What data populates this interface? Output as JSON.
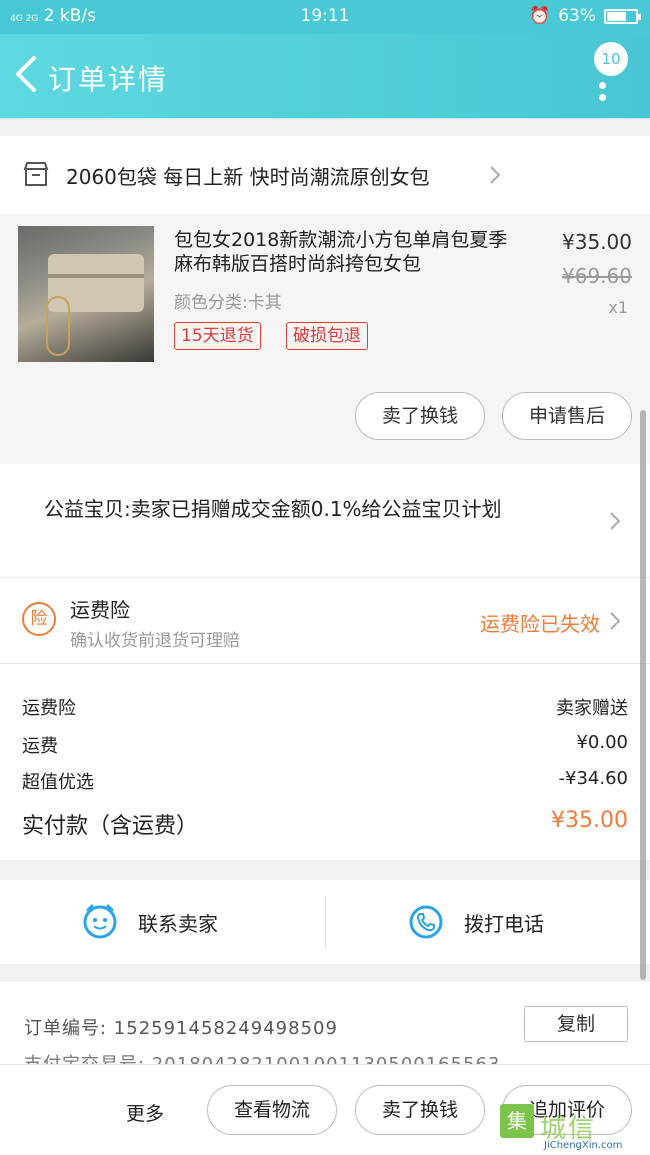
{
  "status_bar": {
    "network": "4G 2G",
    "speed": "2 kB/s",
    "time": "19:11",
    "battery": "63%",
    "battery_level": 0.63
  },
  "header": {
    "title": "订单详情",
    "badge_count": "10"
  },
  "shop": {
    "name": "2060包袋 每日上新 快时尚潮流原创女包"
  },
  "product": {
    "title": "包包女2018新款潮流小方包单肩包夏季麻布韩版百搭时尚斜挎包女包",
    "variant": "颜色分类:卡其",
    "tags": [
      "15天退货",
      "破损包退"
    ],
    "price": "¥35.00",
    "original_price": "¥69.60",
    "quantity": "x1",
    "actions": [
      "卖了换钱",
      "申请售后"
    ]
  },
  "charity": {
    "text": "公益宝贝:卖家已捐赠成交金额0.1%给公益宝贝计划"
  },
  "insurance": {
    "icon": "险",
    "title": "运费险",
    "subtitle": "确认收货前退货可理赔",
    "status": "运费险已失效"
  },
  "fees": [
    {
      "label": "运费险",
      "value": "卖家赠送"
    },
    {
      "label": "运费",
      "value": "¥0.00"
    },
    {
      "label": "超值优选",
      "value": "-¥34.60"
    }
  ],
  "total": {
    "label": "实付款（含运费）",
    "value": "¥35.00"
  },
  "contact": {
    "seller_label": "联系卖家",
    "phone_label": "拨打电话"
  },
  "order": {
    "number": "订单编号:  152591458249498509",
    "alipay": "支付宝交易号:  2018042821001001130500165563",
    "copy_label": "复制"
  },
  "bottom_bar": {
    "more": "更多",
    "buttons": [
      "查看物流",
      "卖了换钱",
      "追加评价"
    ]
  },
  "watermark": {
    "box": "集",
    "cn": "城信",
    "en": "JiChengXin.com"
  },
  "colors": {
    "header": "#49c6d3",
    "accent_orange": "#f07b3a",
    "tag_red": "#e03a3a",
    "icon_blue": "#2aa4e6"
  }
}
